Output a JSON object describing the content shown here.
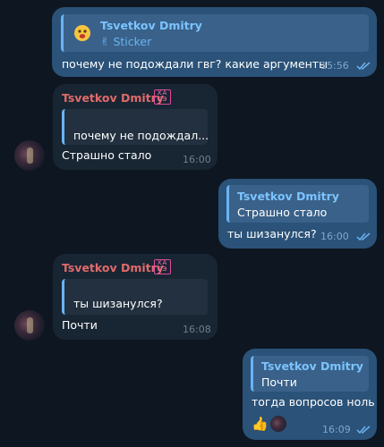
{
  "messages": [
    {
      "reply_name": "Tsvetkov Dmitry",
      "reply_text": "✌ Sticker",
      "text": "почему не подождали гвг? какие аргументы",
      "time": "15:56"
    },
    {
      "sender": "Tsvetkov Dmitry",
      "badge": [
        "ХА",
        "СЭ"
      ],
      "reply_text": "почему не подождал...",
      "text": "Страшно стало",
      "time": "16:00"
    },
    {
      "reply_name": "Tsvetkov Dmitry",
      "reply_text": "Страшно стало",
      "text": "ты шизанулся?",
      "time": "16:00"
    },
    {
      "sender": "Tsvetkov Dmitry",
      "badge": [
        "ХА",
        "СЭ"
      ],
      "reply_text": "ты шизанулся?",
      "text": "Почти",
      "time": "16:08"
    },
    {
      "reply_name": "Tsvetkov Dmitry",
      "reply_text": "Почти",
      "text": "тогда вопросов ноль",
      "reaction": "👍",
      "time": "16:09"
    }
  ],
  "colors": {
    "background": "#0e1621",
    "outgoing": "#2b5278",
    "incoming": "#182533",
    "reply_accent": "#6ab3f3",
    "sender_name": "#e06b6b"
  }
}
